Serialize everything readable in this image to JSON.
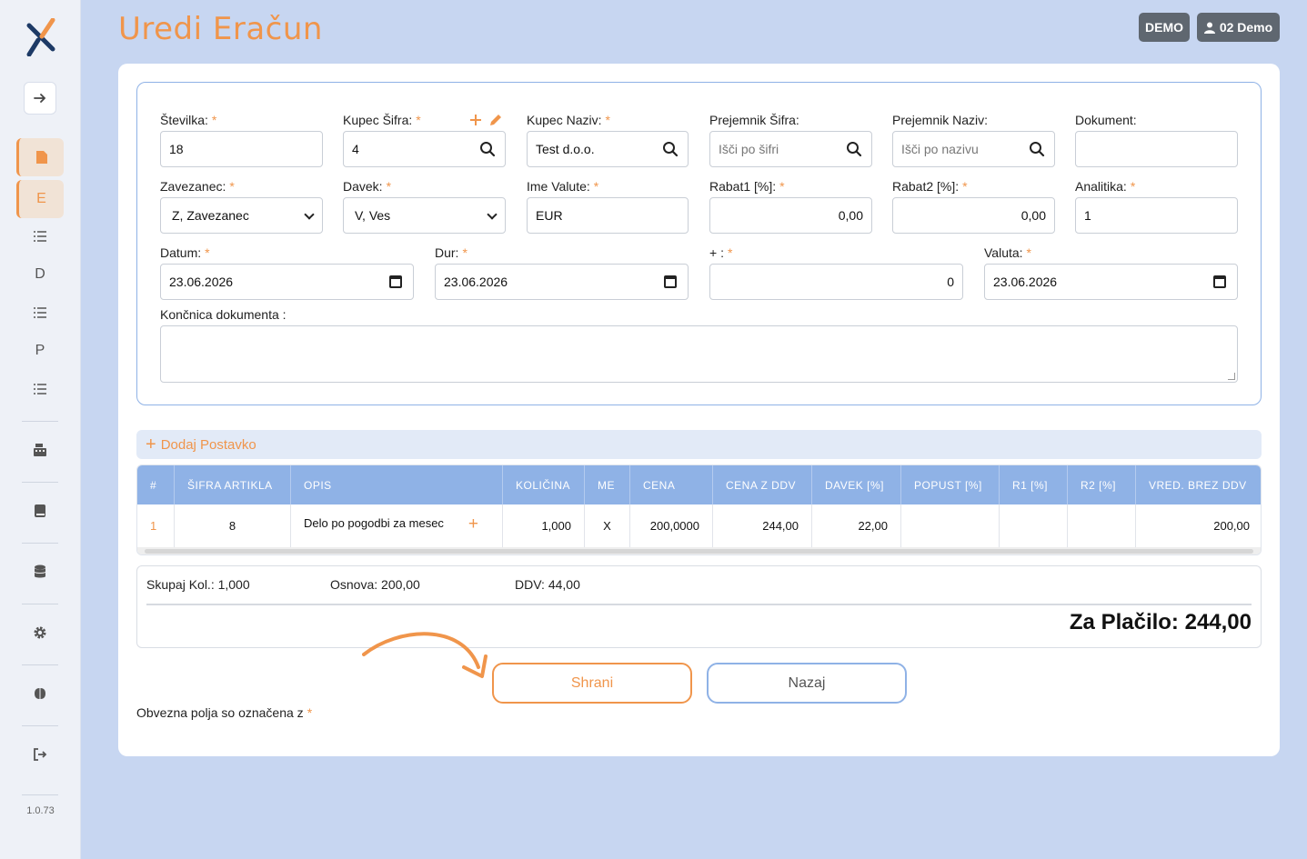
{
  "app": {
    "title": "Uredi Eračun",
    "version": "1.0.73",
    "demo_badge": "DEMO",
    "user_badge": "02 Demo"
  },
  "sidebar": {
    "items": [
      {
        "icon": "arrow-right-icon"
      },
      {
        "icon": "file-icon"
      },
      {
        "label": "E"
      },
      {
        "icon": "list-icon"
      },
      {
        "label": "D"
      },
      {
        "icon": "list-icon"
      },
      {
        "label": "P"
      },
      {
        "icon": "list-icon"
      },
      {
        "icon": "cash-register-icon"
      },
      {
        "icon": "book-icon"
      },
      {
        "icon": "database-icon"
      },
      {
        "icon": "gear-icon"
      },
      {
        "icon": "brain-icon"
      },
      {
        "icon": "logout-icon"
      }
    ]
  },
  "form": {
    "required_mark": "*",
    "stevilka": {
      "label": "Številka:",
      "value": "18"
    },
    "kupec_sifra": {
      "label": "Kupec Šifra:",
      "value": "4"
    },
    "kupec_naziv": {
      "label": "Kupec Naziv:",
      "value": "Test d.o.o."
    },
    "prejemnik_sifra": {
      "label": "Prejemnik Šifra:",
      "placeholder": "Išči po šifri"
    },
    "prejemnik_naziv": {
      "label": "Prejemnik Naziv:",
      "placeholder": "Išči po nazivu"
    },
    "dokument": {
      "label": "Dokument:",
      "value": ""
    },
    "zavezanec": {
      "label": "Zavezanec:",
      "value": "Z, Zavezanec"
    },
    "davek": {
      "label": "Davek:",
      "value": "V, Ves"
    },
    "ime_valute": {
      "label": "Ime Valute:",
      "value": "EUR"
    },
    "rabat1": {
      "label": "Rabat1 [%]:",
      "value": "0,00"
    },
    "rabat2": {
      "label": "Rabat2 [%]:",
      "value": "0,00"
    },
    "analitika": {
      "label": "Analitika:",
      "value": "1"
    },
    "datum": {
      "label": "Datum:",
      "value": "23.06.2026"
    },
    "dur": {
      "label": "Dur:",
      "value": "23.06.2026"
    },
    "plus_field": {
      "label": "+ :",
      "value": "0"
    },
    "valuta": {
      "label": "Valuta:",
      "value": "23.06.2026"
    },
    "koncnica": {
      "label": "Končnica dokumenta :"
    }
  },
  "items": {
    "add_label": "Dodaj Postavko",
    "columns": [
      "#",
      "ŠIFRA ARTIKLA",
      "OPIS",
      "KOLIČINA",
      "ME",
      "CENA",
      "CENA Z DDV",
      "DAVEK [%]",
      "POPUST [%]",
      "R1 [%]",
      "R2 [%]",
      "VRED. BREZ DDV"
    ],
    "rows": [
      [
        "1",
        "8",
        "Delo po pogodbi za mesec",
        "1,000",
        "X",
        "200,0000",
        "244,00",
        "22,00",
        "",
        "",
        "",
        "200,00"
      ]
    ]
  },
  "summary": {
    "skupaj": "Skupaj Kol.: 1,000",
    "osnova": "Osnova: 200,00",
    "ddv": "DDV: 44,00",
    "total": "Za Plačilo: 244,00"
  },
  "buttons": {
    "save": "Shrani",
    "back": "Nazaj"
  },
  "note": {
    "text": "Obvezna polja so označena z"
  },
  "colors": {
    "accent": "#f0954b",
    "primary": "#8fb2e6",
    "background": "#c7d6f1"
  }
}
